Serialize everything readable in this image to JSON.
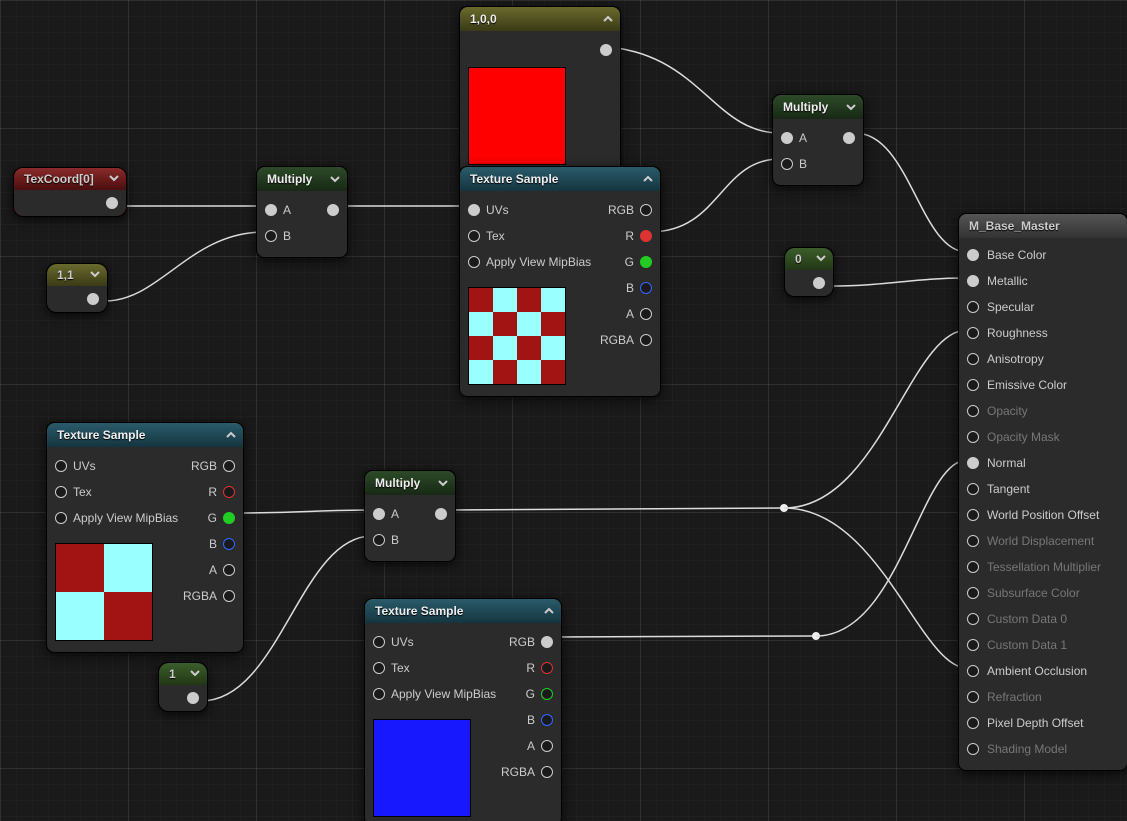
{
  "nodes": {
    "texcoord": {
      "title": "TexCoord[0]"
    },
    "const11": {
      "title": "1,1"
    },
    "const1": {
      "title": "1"
    },
    "const0": {
      "title": "0"
    },
    "vec100": {
      "title": "1,0,0"
    },
    "mul1": {
      "title": "Multiply",
      "a": "A",
      "b": "B"
    },
    "mul2": {
      "title": "Multiply",
      "a": "A",
      "b": "B"
    },
    "mul3": {
      "title": "Multiply",
      "a": "A",
      "b": "B"
    },
    "tex1": {
      "title": "Texture Sample",
      "in": {
        "uvs": "UVs",
        "tex": "Tex",
        "mip": "Apply View MipBias"
      },
      "out": {
        "rgb": "RGB",
        "r": "R",
        "g": "G",
        "b": "B",
        "a": "A",
        "rgba": "RGBA"
      }
    },
    "tex2": {
      "title": "Texture Sample",
      "in": {
        "uvs": "UVs",
        "tex": "Tex",
        "mip": "Apply View MipBias"
      },
      "out": {
        "rgb": "RGB",
        "r": "R",
        "g": "G",
        "b": "B",
        "a": "A",
        "rgba": "RGBA"
      }
    },
    "tex3": {
      "title": "Texture Sample",
      "in": {
        "uvs": "UVs",
        "tex": "Tex",
        "mip": "Apply View MipBias"
      },
      "out": {
        "rgb": "RGB",
        "r": "R",
        "g": "G",
        "b": "B",
        "a": "A",
        "rgba": "RGBA"
      }
    }
  },
  "material": {
    "title": "M_Base_Master",
    "pins": [
      {
        "label": "Base Color",
        "active": true
      },
      {
        "label": "Metallic",
        "active": true
      },
      {
        "label": "Specular",
        "active": false
      },
      {
        "label": "Roughness",
        "active": false
      },
      {
        "label": "Anisotropy",
        "active": false
      },
      {
        "label": "Emissive Color",
        "active": false
      },
      {
        "label": "Opacity",
        "active": false,
        "dim": true
      },
      {
        "label": "Opacity Mask",
        "active": false,
        "dim": true
      },
      {
        "label": "Normal",
        "active": true
      },
      {
        "label": "Tangent",
        "active": false
      },
      {
        "label": "World Position Offset",
        "active": false
      },
      {
        "label": "World Displacement",
        "active": false,
        "dim": true
      },
      {
        "label": "Tessellation Multiplier",
        "active": false,
        "dim": true
      },
      {
        "label": "Subsurface Color",
        "active": false,
        "dim": true
      },
      {
        "label": "Custom Data 0",
        "active": false,
        "dim": true
      },
      {
        "label": "Custom Data 1",
        "active": false,
        "dim": true
      },
      {
        "label": "Ambient Occlusion",
        "active": false
      },
      {
        "label": "Refraction",
        "active": false,
        "dim": true
      },
      {
        "label": "Pixel Depth Offset",
        "active": false
      },
      {
        "label": "Shading Model",
        "active": false,
        "dim": true
      }
    ]
  }
}
